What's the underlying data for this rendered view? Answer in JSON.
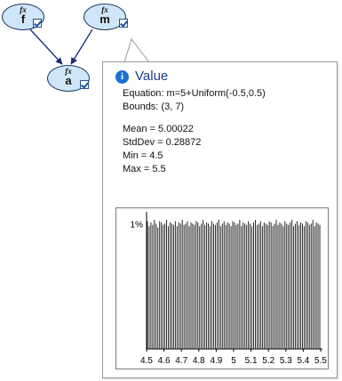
{
  "nodes": [
    {
      "id": "f",
      "fx": "fx",
      "label": "f"
    },
    {
      "id": "m",
      "fx": "fx",
      "label": "m"
    },
    {
      "id": "a",
      "fx": "fx",
      "label": "a"
    }
  ],
  "popup": {
    "title": "Value",
    "equation": "Equation: m=5+Uniform(-0.5,0.5)",
    "bounds": "Bounds: (3, 7)",
    "mean": "Mean = 5.00022",
    "stddev": "StdDev = 0.28872",
    "min": "Min = 4.5",
    "max": "Max = 5.5"
  },
  "chart_data": {
    "type": "bar",
    "title": "",
    "xlabel": "",
    "ylabel": "",
    "ytick_label": "1%",
    "ytick_value": 1,
    "xlim": [
      4.5,
      5.5
    ],
    "ylim": [
      0,
      1.08
    ],
    "xticks": [
      4.5,
      4.6,
      4.7,
      4.8,
      4.9,
      5.0,
      5.1,
      5.2,
      5.3,
      5.4,
      5.5
    ],
    "xtick_labels": [
      "4.5",
      "4.6",
      "4.7",
      "4.8",
      "4.9",
      "5",
      "5.1",
      "5.2",
      "5.3",
      "5.4",
      "5.5"
    ],
    "bins": 100,
    "values": [
      1.02,
      0.98,
      1.01,
      0.99,
      1.03,
      1.0,
      0.97,
      1.02,
      1.01,
      0.99,
      1.0,
      1.03,
      0.98,
      1.01,
      1.0,
      0.99,
      1.02,
      0.98,
      1.01,
      1.0,
      1.03,
      0.99,
      1.0,
      1.02,
      0.98,
      1.01,
      1.0,
      0.99,
      1.02,
      1.01,
      0.98,
      1.0,
      1.03,
      0.99,
      1.01,
      1.0,
      0.98,
      1.02,
      1.0,
      0.99,
      1.01,
      1.03,
      0.98,
      1.0,
      1.02,
      0.99,
      1.01,
      1.0,
      0.98,
      1.02,
      1.01,
      0.99,
      1.0,
      1.03,
      0.98,
      1.01,
      1.0,
      0.99,
      1.02,
      1.0,
      0.98,
      1.01,
      1.03,
      0.99,
      1.0,
      1.02,
      0.98,
      1.01,
      1.0,
      0.99,
      1.02,
      1.01,
      0.98,
      1.0,
      1.03,
      0.99,
      1.01,
      1.0,
      0.98,
      1.02,
      1.0,
      0.99,
      1.01,
      1.03,
      0.98,
      1.0,
      1.02,
      0.99,
      1.01,
      1.0,
      0.98,
      1.02,
      1.01,
      0.99,
      1.0,
      1.03,
      0.98,
      1.01,
      1.0,
      0.99
    ],
    "colors": {
      "bar": "#111111",
      "background": "#ffffff"
    }
  }
}
